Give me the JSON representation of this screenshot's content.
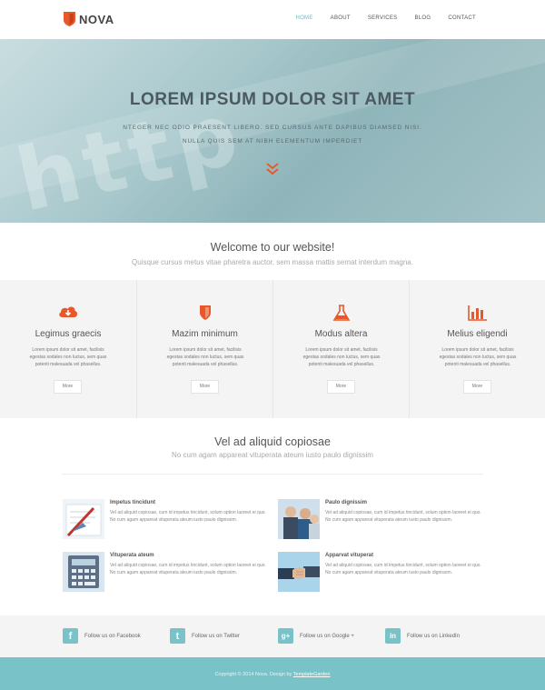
{
  "brand": {
    "name": "NOVA",
    "accent": "#e8582a",
    "teal": "#79c2c8"
  },
  "nav": {
    "items": [
      {
        "label": "HOME",
        "active": true
      },
      {
        "label": "ABOUT",
        "active": false
      },
      {
        "label": "SERVICES",
        "active": false
      },
      {
        "label": "BLOG",
        "active": false
      },
      {
        "label": "CONTACT",
        "active": false
      }
    ]
  },
  "hero": {
    "title": "LOREM IPSUM DOLOR SIT AMET",
    "subtitle_line1": "NTEGER NEC ODIO PRAESENT LIBERO. SED CURSUS ANTE DAPIBUS DIAMSED NISI.",
    "subtitle_line2": "NULLA QUIS SEM AT NIBH ELEMENTUM IMPERDIET",
    "arrow_icon": "double-chevron-down-icon"
  },
  "welcome": {
    "title": "Welcome to our website!",
    "subtitle": "Quisque cursus metus vitae pharetra auctor, sem massa mattis semat interdum magna."
  },
  "features": [
    {
      "icon": "cloud-download-icon",
      "title": "Legimus graecis",
      "text": "Lorem ipsum dolor sit amet, facilisis egestas sodales non luctus, sem quas potenti malesuada vel phasellus.",
      "button": "More"
    },
    {
      "icon": "shield-icon",
      "title": "Mazim minimum",
      "text": "Lorem ipsum dolor sit amet, facilisis egestas sodales non luctus, sem quas potenti malesuada vel phasellus.",
      "button": "More"
    },
    {
      "icon": "flask-icon",
      "title": "Modus altera",
      "text": "Lorem ipsum dolor sit amet, facilisis egestas sodales non luctus, sem quas potenti malesuada vel phasellus.",
      "button": "More"
    },
    {
      "icon": "bar-chart-icon",
      "title": "Melius eligendi",
      "text": "Lorem ipsum dolor sit amet, facilisis egestas sodales non luctus, sem quas potenti malesuada vel phasellus.",
      "button": "More"
    }
  ],
  "section2": {
    "title": "Vel ad aliquid copiosae",
    "subtitle": "No cum agam appareat vituperata ateum iusto paulo dignissim",
    "items": [
      {
        "thumb": "pen-document-thumb",
        "title": "Impetus tincidunt",
        "text": "Vel ad aliquid copiosae, cum id impetus tincidunt, solum option laoreet ei quo. No cum agam appareat vituperata ateum iusto paulo dignissim."
      },
      {
        "thumb": "team-photo-thumb",
        "title": "Paulo dignissim",
        "text": "Vel ad aliquid copiosae, cum id impetus tincidunt, solum option laoreet ei quo. No cum agam appareat vituperata ateum iusto paulo dignissim."
      },
      {
        "thumb": "calculator-thumb",
        "title": "Vituperata ateum",
        "text": "Vel ad aliquid copiosae, cum id impetus tincidunt, solum option laoreet ei quo. No cum agam appareat vituperata ateum iusto paulo dignissim."
      },
      {
        "thumb": "handshake-thumb",
        "title": "Apparvat vituperat",
        "text": "Vel ad aliquid copiosae, cum id impetus tincidunt, solum option laoreet ei quo. No cum agam appareat vituperata ateum iusto paulo dignissim."
      }
    ]
  },
  "social": [
    {
      "icon": "facebook-icon",
      "glyph": "f",
      "label": "Follow us on Facebook"
    },
    {
      "icon": "twitter-icon",
      "glyph": "t",
      "label": "Follow us on Twitter"
    },
    {
      "icon": "google-plus-icon",
      "glyph": "g+",
      "label": "Follow us on Google +"
    },
    {
      "icon": "linkedin-icon",
      "glyph": "in",
      "label": "Follow us on LinkedIn"
    }
  ],
  "footer": {
    "text": "Copyright © 2014 Nova. Design by ",
    "link": "TemplateGarden"
  }
}
